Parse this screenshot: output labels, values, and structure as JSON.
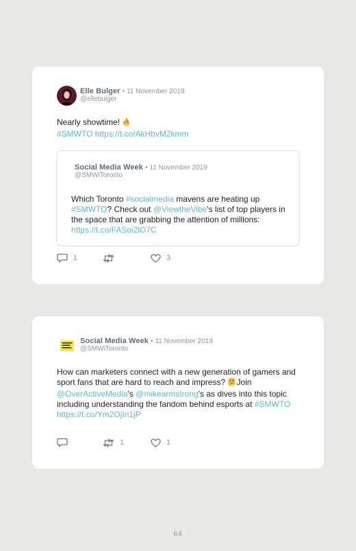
{
  "tweet1": {
    "author_name": "Elle Bulger",
    "separator": "•",
    "date": "11 November 2019",
    "handle": "@ellebulger",
    "text_line1": "Nearly showtime!",
    "emoji_icon": "fire-icon",
    "hashtag": "#SMWTO",
    "link": "https://t.co/AkHbvM2kmm",
    "quoted": {
      "author_name": "Social Media Week",
      "separator": "•",
      "date": "11 November 2019",
      "handle": "@SMWiToronto",
      "text_1": "Which Toronto ",
      "hashtag1": "#socialmedia",
      "text_2": " mavens are heating up ",
      "hashtag2": "#SMWTO",
      "text_3": "? Check out ",
      "mention": "@ViewtheVibe",
      "text_4": "'s list of top players in the space that are grabbing the attention of millions: ",
      "link": "https://t.co/FASoi2lO7C"
    },
    "actions": {
      "reply_count": "1",
      "retweet_count": "",
      "like_count": "3"
    }
  },
  "tweet2": {
    "author_name": "Social Media Week",
    "separator": "•",
    "date": "11 November 2019",
    "handle": "@SMWiToronto",
    "avatar_text": "SOCIAL MEDIA WEEK",
    "text_1": "How can marketers connect with a new generation of gamers and sport fans that are hard to reach and impress? ",
    "emoji_icon": "thinking-face-icon",
    "text_2": "Join ",
    "mention1": "@OverActiveMedia",
    "text_3": "'s ",
    "mention2": "@mikearmstrong",
    "text_4": "'s as dives into this topic including understanding the fandom behind esports at ",
    "hashtag": "#SMWTO",
    "link": "https://t.co/Ym2OjIn1jP",
    "actions": {
      "reply_count": "",
      "retweet_count": "1",
      "like_count": "1"
    }
  },
  "page_number": "64",
  "colors": {
    "background": "#e8e9e4",
    "card": "#ffffff",
    "link": "#5eb6e4",
    "muted": "#8b96a0",
    "name": "#5f6c78"
  }
}
